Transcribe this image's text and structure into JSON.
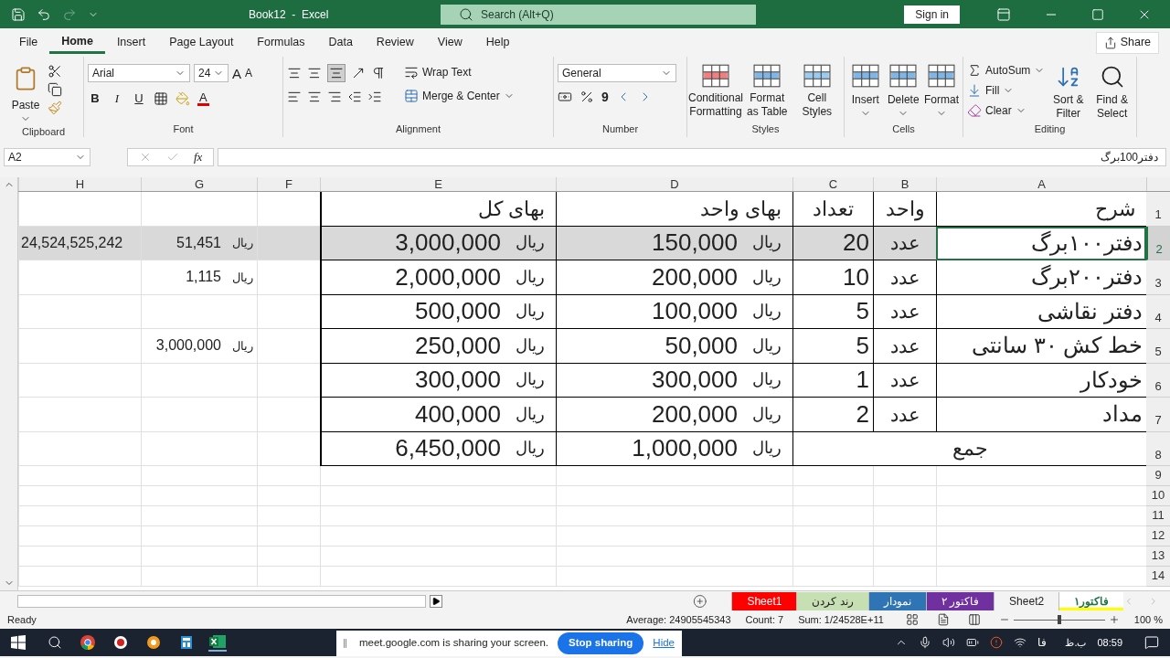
{
  "window": {
    "title": "Book12  -  Excel",
    "search": "Search (Alt+Q)",
    "sign_in": "Sign in"
  },
  "menu_tabs": [
    {
      "label": "Help",
      "selected": false
    },
    {
      "label": "View",
      "selected": false
    },
    {
      "label": "Review",
      "selected": false
    },
    {
      "label": "Data",
      "selected": false
    },
    {
      "label": "Formulas",
      "selected": false
    },
    {
      "label": "Page Layout",
      "selected": false
    },
    {
      "label": "Insert",
      "selected": false
    },
    {
      "label": "Home",
      "selected": true
    },
    {
      "label": "File",
      "selected": false
    }
  ],
  "share": "Share",
  "ribbon": {
    "clipboard": {
      "label": "Clipboard",
      "paste": "Paste"
    },
    "font": {
      "label": "Font",
      "family": "Arial",
      "size": "24",
      "grow": "A",
      "shrink": "A",
      "bold": "B",
      "italic": "I",
      "underline": "U",
      "font_color": "A"
    },
    "alignment": {
      "label": "Alignment",
      "wrap": "Wrap Text",
      "merge": "Merge & Center"
    },
    "number": {
      "label": "Number",
      "format": "General",
      "comma": "9"
    },
    "styles": {
      "label": "Styles",
      "buttons": [
        "Cell Styles",
        "Format as Table",
        "Conditional Formatting"
      ]
    },
    "cells": {
      "label": "Cells",
      "buttons": [
        "Format",
        "Delete",
        "Insert"
      ]
    },
    "editing": {
      "label": "Editing",
      "autosum": "AutoSum",
      "fill": "Fill",
      "clear": "Clear",
      "sort": "Sort & Filter",
      "find": "Find & Select"
    }
  },
  "formula_bar": {
    "name_box": "A2",
    "fx": "fx",
    "formula": "دفتر100برگ"
  },
  "columns": [
    "A",
    "B",
    "C",
    "D",
    "E",
    "F",
    "G",
    "H"
  ],
  "rows": [
    {
      "number": "1",
      "selected": false,
      "cells": [
        {
          "kind": "heading",
          "text": "شرح"
        },
        {
          "kind": "heading",
          "text": "واحد"
        },
        {
          "kind": "heading",
          "text": "تعداد"
        },
        {
          "kind": "heading",
          "text": "بهای واحد"
        },
        {
          "kind": "heading",
          "text": "بهای کل"
        },
        {
          "kind": "blank"
        },
        {
          "kind": "blank"
        },
        {
          "kind": "blank"
        }
      ]
    },
    {
      "number": "2",
      "selected": true,
      "cells": [
        {
          "kind": "label",
          "text": "دفتر۱۰۰برگ"
        },
        {
          "kind": "unit",
          "text": "عدد"
        },
        {
          "kind": "count",
          "text": "20"
        },
        {
          "kind": "money",
          "unit": "ریال",
          "value": "150,000"
        },
        {
          "kind": "money",
          "unit": "ریال",
          "value": "3,000,000"
        },
        {
          "kind": "blank"
        },
        {
          "kind": "note_money",
          "unit": "ریال",
          "value": "51,451"
        },
        {
          "kind": "note",
          "text": "24,524,525,242"
        }
      ]
    },
    {
      "number": "3",
      "selected": false,
      "cells": [
        {
          "kind": "label",
          "text": "دفتر۲۰۰برگ"
        },
        {
          "kind": "unit",
          "text": "عدد"
        },
        {
          "kind": "count",
          "text": "10"
        },
        {
          "kind": "money",
          "unit": "ریال",
          "value": "200,000"
        },
        {
          "kind": "money",
          "unit": "ریال",
          "value": "2,000,000"
        },
        {
          "kind": "blank"
        },
        {
          "kind": "note_money",
          "unit": "ریال",
          "value": "1,115"
        },
        {
          "kind": "blank"
        }
      ]
    },
    {
      "number": "4",
      "selected": false,
      "cells": [
        {
          "kind": "label",
          "text": "دفتر نقاشی"
        },
        {
          "kind": "unit",
          "text": "عدد"
        },
        {
          "kind": "count",
          "text": "5"
        },
        {
          "kind": "money",
          "unit": "ریال",
          "value": "100,000"
        },
        {
          "kind": "money",
          "unit": "ریال",
          "value": "500,000"
        },
        {
          "kind": "blank"
        },
        {
          "kind": "blank"
        },
        {
          "kind": "blank"
        }
      ]
    },
    {
      "number": "5",
      "selected": false,
      "cells": [
        {
          "kind": "label",
          "text": "خط کش ۳۰ سانتی"
        },
        {
          "kind": "unit",
          "text": "عدد"
        },
        {
          "kind": "count",
          "text": "5"
        },
        {
          "kind": "money",
          "unit": "ریال",
          "value": "50,000"
        },
        {
          "kind": "money",
          "unit": "ریال",
          "value": "250,000"
        },
        {
          "kind": "blank"
        },
        {
          "kind": "note_money",
          "unit": "ریال",
          "value": "3,000,000"
        },
        {
          "kind": "blank"
        }
      ]
    },
    {
      "number": "6",
      "selected": false,
      "cells": [
        {
          "kind": "label",
          "text": "خودکار"
        },
        {
          "kind": "unit",
          "text": "عدد"
        },
        {
          "kind": "count",
          "text": "1"
        },
        {
          "kind": "money",
          "unit": "ریال",
          "value": "300,000"
        },
        {
          "kind": "money",
          "unit": "ریال",
          "value": "300,000"
        },
        {
          "kind": "blank"
        },
        {
          "kind": "blank"
        },
        {
          "kind": "blank"
        }
      ]
    },
    {
      "number": "7",
      "selected": false,
      "cells": [
        {
          "kind": "label",
          "text": "مداد"
        },
        {
          "kind": "unit",
          "text": "عدد"
        },
        {
          "kind": "count",
          "text": "2"
        },
        {
          "kind": "money",
          "unit": "ریال",
          "value": "200,000"
        },
        {
          "kind": "money",
          "unit": "ریال",
          "value": "400,000"
        },
        {
          "kind": "blank"
        },
        {
          "kind": "blank"
        },
        {
          "kind": "blank"
        }
      ]
    },
    {
      "number": "8",
      "selected": false,
      "cells": [
        {
          "kind": "merged",
          "text": "جمع"
        },
        {
          "kind": "money",
          "unit": "ریال",
          "value": "1,000,000"
        },
        {
          "kind": "money",
          "unit": "ریال",
          "value": "6,450,000"
        },
        {
          "kind": "blank"
        },
        {
          "kind": "blank"
        },
        {
          "kind": "blank"
        }
      ]
    },
    {
      "number": "9",
      "selected": false
    },
    {
      "number": "10",
      "selected": false
    },
    {
      "number": "11",
      "selected": false
    },
    {
      "number": "12",
      "selected": false
    },
    {
      "number": "13",
      "selected": false
    },
    {
      "number": "14",
      "selected": false
    }
  ],
  "sheet_tabs": [
    {
      "label": "فاکتور۱",
      "selected": true,
      "color": "#ffff00"
    },
    {
      "label": "Sheet2",
      "selected": false
    },
    {
      "label": "فاکتور ۲",
      "selected": false,
      "color": "#7030a0"
    },
    {
      "label": "نمودار",
      "selected": false,
      "color": "#2f75b5"
    },
    {
      "label": "رند کردن",
      "selected": false,
      "color": "#c6e0b4"
    },
    {
      "label": "Sheet1",
      "selected": false,
      "color": "#ff0000"
    }
  ],
  "status_bar": {
    "ready": "Ready",
    "average": "Average: 24905545343",
    "count": "Count: 7",
    "sum": "Sum: 1/24528E+11",
    "zoom_slider": {
      "level": 0.5
    },
    "zoom": "100 %"
  },
  "sharing_bar": {
    "message": "meet.google.com is sharing your screen.",
    "stop": "Stop sharing",
    "hide": "Hide"
  },
  "taskbar": {
    "language": "فا",
    "period": "ب.ظ",
    "time": "08:59"
  }
}
